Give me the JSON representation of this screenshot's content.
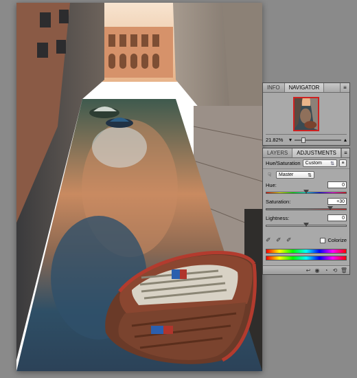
{
  "navigator": {
    "tabs": {
      "info": "INFO",
      "navigator": "NAVIGATOR"
    },
    "zoom_pct": "21.82%"
  },
  "adjustments": {
    "tabs": {
      "layers": "LAYERS",
      "adjustments": "ADJUSTMENTS"
    },
    "adjustment_label": "Hue/Saturation",
    "preset": "Custom",
    "channel": "Master",
    "sliders": {
      "hue": {
        "label": "Hue:",
        "value": "0",
        "pos_pct": 50
      },
      "saturation": {
        "label": "Saturation:",
        "value": "+30",
        "pos_pct": 80
      },
      "lightness": {
        "label": "Lightness:",
        "value": "0",
        "pos_pct": 50
      }
    },
    "colorize_label": "Colorize",
    "colorize_checked": false
  },
  "image_description": "Photograph of a narrow Venetian canal. Tall weathered stucco buildings in ochre, terracotta and grey line both sides, with small balconies and shuttered windows. The still green-blue water reflects a sunlit peach-colored palazzo at the far end and patches of blue sky. In the foreground right a wooden rowboat with red gunwales and slatted white floorboards is moored against a stone wall; a couple of small covered motorboats sit farther back on the left."
}
